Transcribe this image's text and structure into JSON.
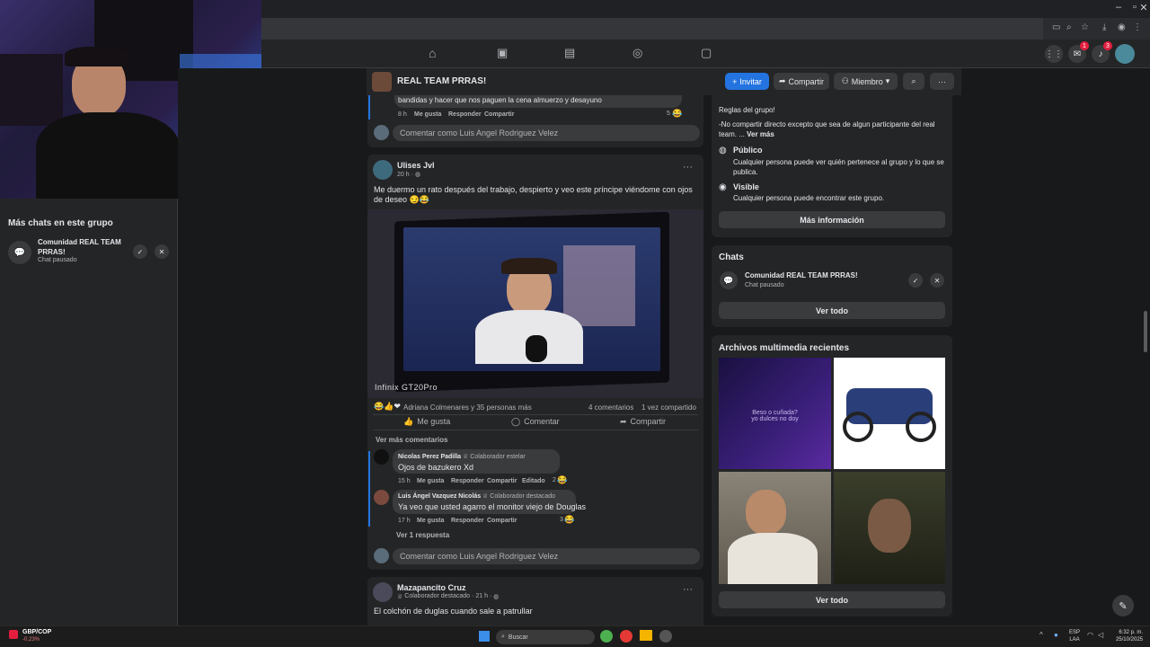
{
  "group": {
    "name": "REAL TEAM PRRAS!",
    "invite": "Invitar",
    "share": "Compartir",
    "member": "Miembro"
  },
  "notifications": {
    "messenger_count": "1",
    "bell_count": "3"
  },
  "left_panel": {
    "heading": "Más chats en este grupo",
    "chat_name": "Comunidad REAL TEAM PRRAS!",
    "chat_status": "Chat pausado"
  },
  "post_top": {
    "snippet": "bandidas y hacer que nos paguen la cena almuerzo y desayuno",
    "time": "8 h",
    "like": "Me gusta",
    "reply": "Responder",
    "share": "Compartir",
    "count": "5"
  },
  "comment_placeholder": "Comentar como Luis Angel Rodriguez Velez",
  "post": {
    "author": "Ulises Jvl",
    "time": "20 h · ",
    "text": "Me duermo un rato después del trabajo, despierto y veo este príncipe viéndome con ojos de deseo",
    "image_caption": "Infinix GT20Pro",
    "reactions": "Adriana Colmenares y 35 personas más",
    "comments_count": "4 comentarios",
    "shares_count": "1 vez compartido",
    "like": "Me gusta",
    "comment": "Comentar",
    "share": "Compartir",
    "more_comments": "Ver más comentarios"
  },
  "comments": [
    {
      "author": "Nicolas Perez Padilla",
      "badge": "Colaborador estelar",
      "text": "Ojos de bazukero Xd",
      "time": "15 h",
      "like": "Me gusta",
      "reply": "Responder",
      "share": "Compartir",
      "edited": "Editado",
      "count": "2"
    },
    {
      "author": "Luis Ángel Vazquez Nicolás",
      "badge": "Colaborador destacado",
      "text": "Ya veo que usted agarro el monitor viejo de Douglas",
      "time": "17 h",
      "like": "Me gusta",
      "reply": "Responder",
      "share": "Compartir",
      "count": "3"
    }
  ],
  "view_reply": "Ver 1 respuesta",
  "post2": {
    "author": "Mazapancito Cruz",
    "badge": "Colaborador destacado",
    "time": "· 21 h · ",
    "text": "El colchón de duglas cuando sale a patrullar"
  },
  "sidebar": {
    "rules_title": "Reglas del grupo!",
    "rules_text": "-No compartir directo excepto que sea de algun participante del real team. ...",
    "see_more": "Ver más",
    "public_title": "Público",
    "public_desc": "Cualquier persona puede ver quién pertenece al grupo y lo que se publica.",
    "visible_title": "Visible",
    "visible_desc": "Cualquier persona puede encontrar este grupo.",
    "more_info": "Más información",
    "chats_title": "Chats",
    "chat_name": "Comunidad REAL TEAM PRRAS!",
    "chat_status": "Chat pausado",
    "see_all": "Ver todo",
    "media_title": "Archivos multimedia recientes",
    "media_caption": "Beso o cuñada?\nyo dulces no doy",
    "see_all_media": "Ver todo"
  },
  "taskbar": {
    "ticker": "GBP/COP",
    "ticker_change": "-0,23%",
    "search": "Buscar",
    "lang1": "ESP",
    "lang2": "LAA",
    "time": "6:32 p. m.",
    "date": "25/10/2025"
  },
  "colors": {
    "accent": "#2374e1",
    "badge_red": "#e41e3f",
    "bg": "#18191a",
    "card": "#242526"
  }
}
